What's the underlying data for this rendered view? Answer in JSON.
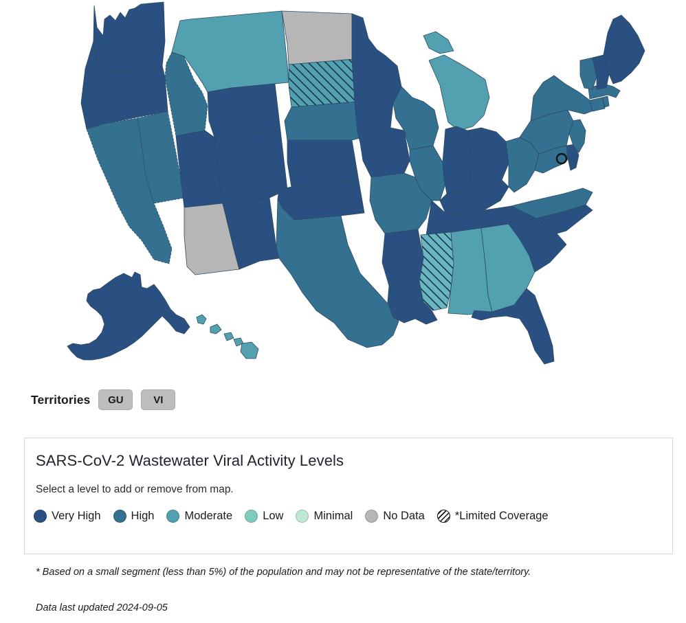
{
  "territories": {
    "label": "Territories",
    "chips": [
      {
        "code": "GU"
      },
      {
        "code": "VI"
      }
    ]
  },
  "legend": {
    "title": "SARS-CoV-2 Wastewater Viral Activity Levels",
    "subtitle": "Select a level to add or remove from map.",
    "items": [
      {
        "label": "Very High",
        "color": "#2a5082",
        "kind": "solid"
      },
      {
        "label": "High",
        "color": "#34708f",
        "kind": "solid"
      },
      {
        "label": "Moderate",
        "color": "#52a0b0",
        "kind": "solid"
      },
      {
        "label": "Low",
        "color": "#81cbbd",
        "kind": "solid"
      },
      {
        "label": "Minimal",
        "color": "#bfe8d5",
        "kind": "solid"
      },
      {
        "label": "No Data",
        "color": "#b6b6b6",
        "kind": "solid"
      },
      {
        "label": "*Limited Coverage",
        "color": "#ffffff",
        "kind": "hatch"
      }
    ]
  },
  "footnotes": {
    "coverage": "* Based on a small segment (less than 5%) of the population and may not be representative of the state/territory.",
    "updated": "Data last updated 2024-09-05"
  },
  "map": {
    "dc_marker_label": "District of Columbia",
    "states": [
      {
        "code": "WA",
        "name": "Washington",
        "level": "Very High",
        "color": "#2a5082",
        "limited_coverage": false
      },
      {
        "code": "OR",
        "name": "Oregon",
        "level": "Very High",
        "color": "#2a5082",
        "limited_coverage": false
      },
      {
        "code": "CA",
        "name": "California",
        "level": "High",
        "color": "#34708f",
        "limited_coverage": false
      },
      {
        "code": "NV",
        "name": "Nevada",
        "level": "High",
        "color": "#34708f",
        "limited_coverage": false
      },
      {
        "code": "ID",
        "name": "Idaho",
        "level": "High",
        "color": "#34708f",
        "limited_coverage": false
      },
      {
        "code": "MT",
        "name": "Montana",
        "level": "Moderate",
        "color": "#52a0b0",
        "limited_coverage": false
      },
      {
        "code": "WY",
        "name": "Wyoming",
        "level": "Very High",
        "color": "#2a5082",
        "limited_coverage": false
      },
      {
        "code": "UT",
        "name": "Utah",
        "level": "Very High",
        "color": "#2a5082",
        "limited_coverage": false
      },
      {
        "code": "AZ",
        "name": "Arizona",
        "level": "No Data",
        "color": "#b6b6b6",
        "limited_coverage": false
      },
      {
        "code": "NM",
        "name": "New Mexico",
        "level": "Very High",
        "color": "#2a5082",
        "limited_coverage": false
      },
      {
        "code": "CO",
        "name": "Colorado",
        "level": "Very High",
        "color": "#2a5082",
        "limited_coverage": false
      },
      {
        "code": "ND",
        "name": "North Dakota",
        "level": "No Data",
        "color": "#b6b6b6",
        "limited_coverage": false
      },
      {
        "code": "SD",
        "name": "South Dakota",
        "level": "High",
        "color": "#34708f",
        "limited_coverage": true
      },
      {
        "code": "NE",
        "name": "Nebraska",
        "level": "High",
        "color": "#34708f",
        "limited_coverage": false
      },
      {
        "code": "KS",
        "name": "Kansas",
        "level": "Very High",
        "color": "#2a5082",
        "limited_coverage": false
      },
      {
        "code": "OK",
        "name": "Oklahoma",
        "level": "Very High",
        "color": "#2a5082",
        "limited_coverage": false
      },
      {
        "code": "TX",
        "name": "Texas",
        "level": "High",
        "color": "#34708f",
        "limited_coverage": false
      },
      {
        "code": "MN",
        "name": "Minnesota",
        "level": "Very High",
        "color": "#2a5082",
        "limited_coverage": false
      },
      {
        "code": "IA",
        "name": "Iowa",
        "level": "Very High",
        "color": "#2a5082",
        "limited_coverage": false
      },
      {
        "code": "MO",
        "name": "Missouri",
        "level": "High",
        "color": "#34708f",
        "limited_coverage": false
      },
      {
        "code": "AR",
        "name": "Arkansas",
        "level": "Very High",
        "color": "#2a5082",
        "limited_coverage": false
      },
      {
        "code": "LA",
        "name": "Louisiana",
        "level": "Very High",
        "color": "#2a5082",
        "limited_coverage": false
      },
      {
        "code": "WI",
        "name": "Wisconsin",
        "level": "High",
        "color": "#34708f",
        "limited_coverage": false
      },
      {
        "code": "IL",
        "name": "Illinois",
        "level": "High",
        "color": "#34708f",
        "limited_coverage": false
      },
      {
        "code": "MI",
        "name": "Michigan",
        "level": "Moderate",
        "color": "#52a0b0",
        "limited_coverage": false
      },
      {
        "code": "IN",
        "name": "Indiana",
        "level": "Very High",
        "color": "#2a5082",
        "limited_coverage": false
      },
      {
        "code": "OH",
        "name": "Ohio",
        "level": "Very High",
        "color": "#2a5082",
        "limited_coverage": false
      },
      {
        "code": "KY",
        "name": "Kentucky",
        "level": "Very High",
        "color": "#2a5082",
        "limited_coverage": false
      },
      {
        "code": "TN",
        "name": "Tennessee",
        "level": "Very High",
        "color": "#2a5082",
        "limited_coverage": false
      },
      {
        "code": "MS",
        "name": "Mississippi",
        "level": "Moderate",
        "color": "#52a0b0",
        "limited_coverage": true
      },
      {
        "code": "AL",
        "name": "Alabama",
        "level": "Moderate",
        "color": "#52a0b0",
        "limited_coverage": false
      },
      {
        "code": "GA",
        "name": "Georgia",
        "level": "Moderate",
        "color": "#52a0b0",
        "limited_coverage": false
      },
      {
        "code": "FL",
        "name": "Florida",
        "level": "Very High",
        "color": "#2a5082",
        "limited_coverage": false
      },
      {
        "code": "SC",
        "name": "South Carolina",
        "level": "Very High",
        "color": "#2a5082",
        "limited_coverage": false
      },
      {
        "code": "NC",
        "name": "North Carolina",
        "level": "Very High",
        "color": "#2a5082",
        "limited_coverage": false
      },
      {
        "code": "VA",
        "name": "Virginia",
        "level": "High",
        "color": "#34708f",
        "limited_coverage": false
      },
      {
        "code": "WV",
        "name": "West Virginia",
        "level": "High",
        "color": "#34708f",
        "limited_coverage": false
      },
      {
        "code": "MD",
        "name": "Maryland",
        "level": "High",
        "color": "#34708f",
        "limited_coverage": false
      },
      {
        "code": "DE",
        "name": "Delaware",
        "level": "Very High",
        "color": "#2a5082",
        "limited_coverage": false
      },
      {
        "code": "NJ",
        "name": "New Jersey",
        "level": "High",
        "color": "#34708f",
        "limited_coverage": false
      },
      {
        "code": "PA",
        "name": "Pennsylvania",
        "level": "High",
        "color": "#34708f",
        "limited_coverage": false
      },
      {
        "code": "NY",
        "name": "New York",
        "level": "High",
        "color": "#34708f",
        "limited_coverage": false
      },
      {
        "code": "CT",
        "name": "Connecticut",
        "level": "High",
        "color": "#34708f",
        "limited_coverage": false
      },
      {
        "code": "RI",
        "name": "Rhode Island",
        "level": "High",
        "color": "#34708f",
        "limited_coverage": false
      },
      {
        "code": "MA",
        "name": "Massachusetts",
        "level": "High",
        "color": "#34708f",
        "limited_coverage": false
      },
      {
        "code": "VT",
        "name": "Vermont",
        "level": "High",
        "color": "#34708f",
        "limited_coverage": false
      },
      {
        "code": "NH",
        "name": "New Hampshire",
        "level": "Very High",
        "color": "#2a5082",
        "limited_coverage": false
      },
      {
        "code": "ME",
        "name": "Maine",
        "level": "Very High",
        "color": "#2a5082",
        "limited_coverage": false
      },
      {
        "code": "AK",
        "name": "Alaska",
        "level": "Very High",
        "color": "#2a5082",
        "limited_coverage": false
      },
      {
        "code": "HI",
        "name": "Hawaii",
        "level": "Moderate",
        "color": "#52a0b0",
        "limited_coverage": false
      }
    ]
  }
}
